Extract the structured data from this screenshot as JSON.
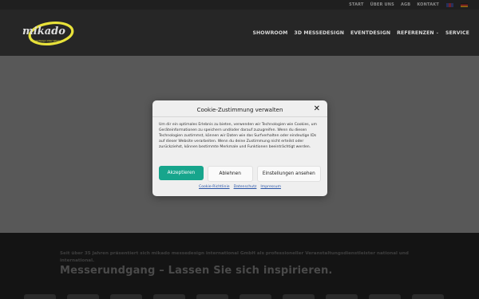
{
  "topbar": {
    "links": [
      "START",
      "ÜBER UNS",
      "AGB",
      "KONTAKT"
    ]
  },
  "logo": {
    "brand": "mikado",
    "tagline": "messedesign international"
  },
  "nav": {
    "items": [
      "SHOWROOM",
      "3D MESSEDESIGN",
      "EVENTDESIGN",
      "REFERENZEN",
      "SERVICE"
    ]
  },
  "lower": {
    "intro": "Seit über 35 Jahren präsentiert sich mikado messedesign international GmbH als professioneller Veranstaltungsdienstleister national und international.",
    "headline": "Messerundgang – Lassen Sie sich inspirieren."
  },
  "cookie": {
    "title": "Cookie-Zustimmung verwalten",
    "body": "Um dir ein optimales Erlebnis zu bieten, verwenden wir Technologien wie Cookies, um Geräteinformationen zu speichern und/oder darauf zuzugreifen. Wenn du diesen Technologien zustimmst, können wir Daten wie das Surfverhalten oder eindeutige IDs auf dieser Website verarbeiten. Wenn du deine Zustimmung nicht erteilst oder zurückziehst, können bestimmte Merkmale und Funktionen beeinträchtigt werden.",
    "accept": "Akzeptieren",
    "reject": "Ablehnen",
    "settings": "Einstellungen ansehen",
    "links": [
      "Cookie-Richtlinie",
      "Datenschutz",
      "Impressum"
    ]
  },
  "colors": {
    "accent": "#17a58c",
    "logo_yellow": "#e8e23a"
  }
}
